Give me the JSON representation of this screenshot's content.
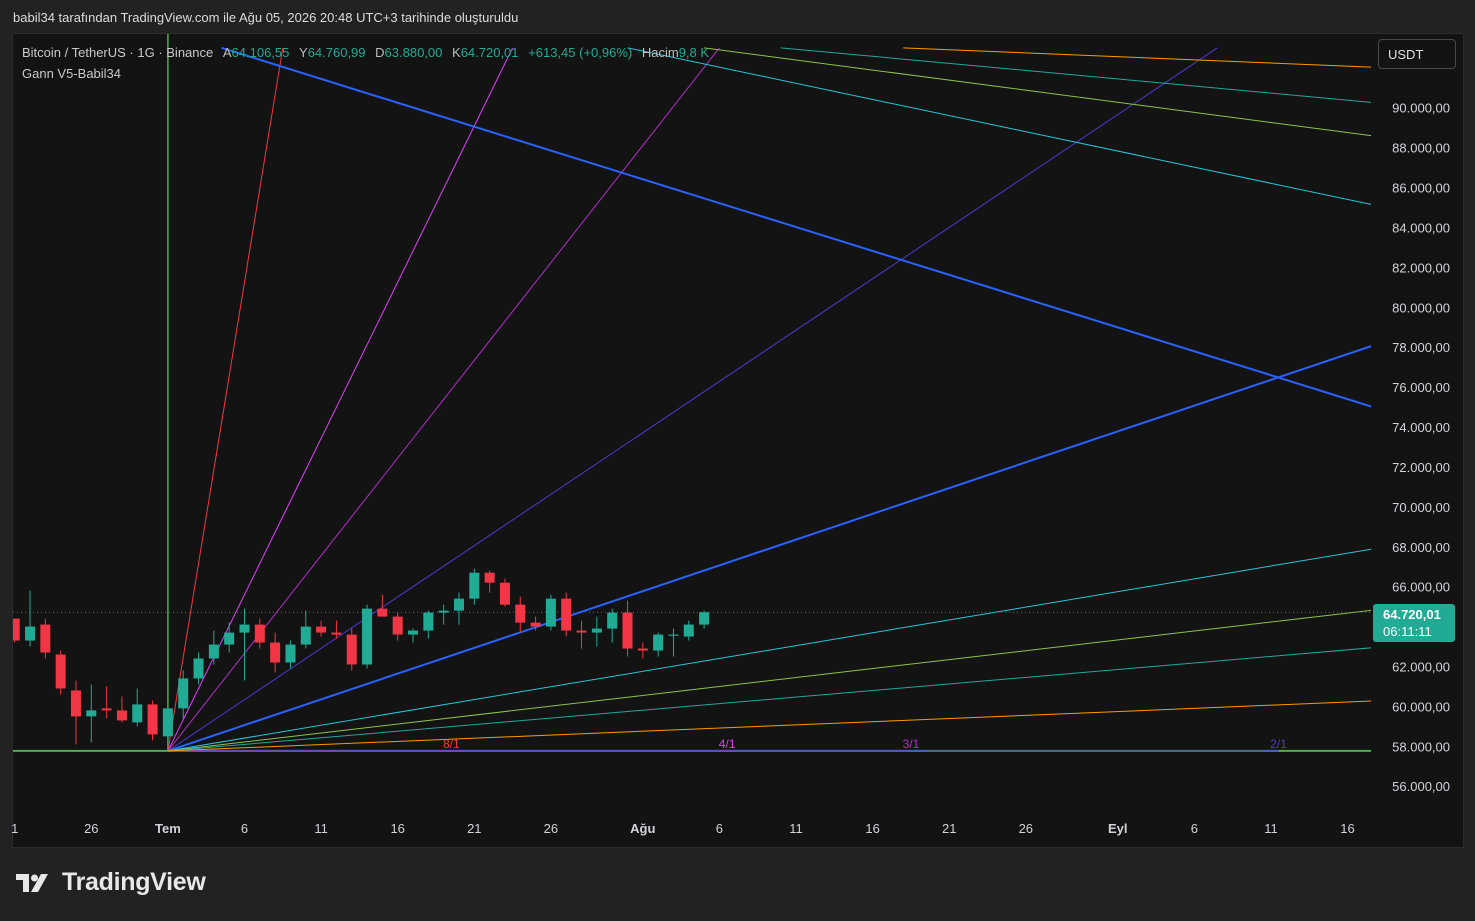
{
  "header": {
    "credit": "babil34 tarafından TradingView.com ile Ağu 05, 2026 20:48 UTC+3 tarihinde oluşturuldu"
  },
  "legend": {
    "symbol": "Bitcoin / TetherUS · 1G · Binance",
    "open_label": "A",
    "open": "64.106,55",
    "high_label": "Y",
    "high": "64.760,99",
    "low_label": "D",
    "low": "63.880,00",
    "close_label": "K",
    "close": "64.720,01",
    "change": "+613,45 (+0,96%)",
    "volume_label": "Hacim",
    "volume": "9,8 K",
    "indicator": "Gann V5-Babil34"
  },
  "currency_button": "USDT",
  "price_tag": {
    "price": "64.720,01",
    "countdown": "06:11:11"
  },
  "brand": {
    "name": "TradingView",
    "icon": "tradingview-logo-icon"
  },
  "colors": {
    "bull": "#22ab94",
    "bear": "#f23645",
    "background": "#131313",
    "baseline": "#4caf50"
  },
  "chart_data": {
    "type": "candlestick",
    "y_axis": {
      "ticks": [
        56000,
        58000,
        60000,
        62000,
        64000,
        66000,
        68000,
        70000,
        72000,
        74000,
        76000,
        78000,
        80000,
        82000,
        84000,
        86000,
        88000,
        90000
      ],
      "tick_labels": [
        "56.000,00",
        "58.000,00",
        "60.000,00",
        "62.000,00",
        "",
        "66.000,00",
        "68.000,00",
        "70.000,00",
        "72.000,00",
        "74.000,00",
        "76.000,00",
        "78.000,00",
        "80.000,00",
        "82.000,00",
        "84.000,00",
        "86.000,00",
        "88.000,00",
        "90.000,00"
      ],
      "range": [
        55000,
        92500
      ]
    },
    "x_axis": {
      "start_date": "2026-06-21",
      "labels": [
        {
          "day": 0,
          "text": "1"
        },
        {
          "day": 5,
          "text": "26"
        },
        {
          "day": 10,
          "text": "Tem"
        },
        {
          "day": 15,
          "text": "6"
        },
        {
          "day": 20,
          "text": "11"
        },
        {
          "day": 25,
          "text": "16"
        },
        {
          "day": 30,
          "text": "21"
        },
        {
          "day": 35,
          "text": "26"
        },
        {
          "day": 41,
          "text": "Ağu"
        },
        {
          "day": 46,
          "text": "6"
        },
        {
          "day": 51,
          "text": "11"
        },
        {
          "day": 56,
          "text": "16"
        },
        {
          "day": 61,
          "text": "21"
        },
        {
          "day": 66,
          "text": "26"
        },
        {
          "day": 72,
          "text": "Eyl"
        },
        {
          "day": 77,
          "text": "6"
        },
        {
          "day": 82,
          "text": "11"
        },
        {
          "day": 87,
          "text": "16"
        }
      ]
    },
    "last_price": 64720.01,
    "gann_origin": {
      "day": 10,
      "price": 57770
    },
    "gann_baseline": 57770,
    "gann_labels": [
      {
        "text": "8/1",
        "day": 28.5,
        "color": "#f23645"
      },
      {
        "text": "4/1",
        "day": 46.5,
        "color": "#e040fb"
      },
      {
        "text": "3/1",
        "day": 58.5,
        "color": "#b030c8"
      },
      {
        "text": "2/1",
        "day": 82.5,
        "color": "#4a3ad0"
      }
    ],
    "fan_lines": [
      {
        "to": [
          28.5,
          57770
        ],
        "color": "#f23645",
        "width": 1
      },
      {
        "to": [
          46.5,
          57770
        ],
        "color": "#e040fb",
        "width": 1
      },
      {
        "to": [
          58.5,
          57770
        ],
        "color": "#b030c8",
        "width": 1
      },
      {
        "to": [
          82.5,
          57770
        ],
        "color": "#4a3ad0",
        "width": 1
      },
      {
        "to": [
          17.5,
          93000
        ],
        "color": "#f23645",
        "width": 1
      },
      {
        "to": [
          32.5,
          93000
        ],
        "color": "#e040fb",
        "width": 1
      },
      {
        "to": [
          46,
          93000
        ],
        "color": "#b030c8",
        "width": 1
      },
      {
        "to": [
          78.5,
          93000
        ],
        "color": "#4a3ad0",
        "width": 1
      },
      {
        "to": [
          89.5,
          78300
        ],
        "color": "#2962ff",
        "width": 2
      },
      {
        "to": [
          89.5,
          68000
        ],
        "color": "#26c6da",
        "width": 1
      },
      {
        "to": [
          89.5,
          64900
        ],
        "color": "#8bc34a",
        "width": 1
      },
      {
        "to": [
          89.5,
          63000
        ],
        "color": "#26a69a",
        "width": 1
      },
      {
        "to": [
          89.5,
          60300
        ],
        "color": "#ff9800",
        "width": 1
      }
    ],
    "down_lines": [
      {
        "from": [
          13.5,
          93000
        ],
        "to": [
          89.5,
          74800
        ],
        "color": "#2962ff",
        "width": 2
      },
      {
        "from": [
          40,
          93000
        ],
        "to": [
          89.5,
          85000
        ],
        "color": "#26c6da",
        "width": 1
      },
      {
        "from": [
          45,
          93000
        ],
        "to": [
          89.5,
          88500
        ],
        "color": "#8bc34a",
        "width": 1
      },
      {
        "from": [
          50,
          93000
        ],
        "to": [
          89.5,
          90200
        ],
        "color": "#26a69a",
        "width": 1
      },
      {
        "from": [
          58,
          93000
        ],
        "to": [
          89.5,
          92000
        ],
        "color": "#ff9800",
        "width": 1
      }
    ],
    "candles": [
      {
        "d": 0,
        "o": 64400,
        "h": 64400,
        "l": 63200,
        "c": 63300
      },
      {
        "d": 1,
        "o": 63300,
        "h": 65800,
        "l": 63000,
        "c": 64000
      },
      {
        "d": 2,
        "o": 64100,
        "h": 64400,
        "l": 62400,
        "c": 62700
      },
      {
        "d": 3,
        "o": 62600,
        "h": 62800,
        "l": 60600,
        "c": 60900
      },
      {
        "d": 4,
        "o": 60800,
        "h": 61300,
        "l": 58100,
        "c": 59500
      },
      {
        "d": 5,
        "o": 59500,
        "h": 61100,
        "l": 58200,
        "c": 59800
      },
      {
        "d": 6,
        "o": 59900,
        "h": 61000,
        "l": 59400,
        "c": 59800
      },
      {
        "d": 7,
        "o": 59800,
        "h": 60500,
        "l": 59200,
        "c": 59300
      },
      {
        "d": 8,
        "o": 59200,
        "h": 60900,
        "l": 59000,
        "c": 60100
      },
      {
        "d": 9,
        "o": 60100,
        "h": 60300,
        "l": 58300,
        "c": 58600
      },
      {
        "d": 10,
        "o": 58500,
        "h": 60000,
        "l": 57800,
        "c": 59900
      },
      {
        "d": 11,
        "o": 59900,
        "h": 61800,
        "l": 59400,
        "c": 61400
      },
      {
        "d": 12,
        "o": 61400,
        "h": 62700,
        "l": 61100,
        "c": 62400
      },
      {
        "d": 13,
        "o": 62400,
        "h": 63800,
        "l": 62100,
        "c": 63100
      },
      {
        "d": 14,
        "o": 63100,
        "h": 64200,
        "l": 62700,
        "c": 63700
      },
      {
        "d": 15,
        "o": 63700,
        "h": 64900,
        "l": 61300,
        "c": 64100
      },
      {
        "d": 16,
        "o": 64100,
        "h": 64400,
        "l": 62900,
        "c": 63200
      },
      {
        "d": 17,
        "o": 63200,
        "h": 63700,
        "l": 61700,
        "c": 62200
      },
      {
        "d": 18,
        "o": 62200,
        "h": 63300,
        "l": 61900,
        "c": 63100
      },
      {
        "d": 19,
        "o": 63100,
        "h": 64800,
        "l": 62900,
        "c": 64000
      },
      {
        "d": 20,
        "o": 64000,
        "h": 64300,
        "l": 63500,
        "c": 63700
      },
      {
        "d": 21,
        "o": 63700,
        "h": 64300,
        "l": 63400,
        "c": 63600
      },
      {
        "d": 22,
        "o": 63600,
        "h": 63900,
        "l": 61800,
        "c": 62100
      },
      {
        "d": 23,
        "o": 62100,
        "h": 65100,
        "l": 61900,
        "c": 64900
      },
      {
        "d": 24,
        "o": 64900,
        "h": 65600,
        "l": 64500,
        "c": 64500
      },
      {
        "d": 25,
        "o": 64500,
        "h": 64700,
        "l": 63300,
        "c": 63600
      },
      {
        "d": 26,
        "o": 63600,
        "h": 63900,
        "l": 63200,
        "c": 63800
      },
      {
        "d": 27,
        "o": 63800,
        "h": 64800,
        "l": 63400,
        "c": 64700
      },
      {
        "d": 28,
        "o": 64700,
        "h": 65100,
        "l": 64100,
        "c": 64800
      },
      {
        "d": 29,
        "o": 64800,
        "h": 65700,
        "l": 64100,
        "c": 65400
      },
      {
        "d": 30,
        "o": 65400,
        "h": 66900,
        "l": 65100,
        "c": 66700
      },
      {
        "d": 31,
        "o": 66700,
        "h": 66800,
        "l": 65700,
        "c": 66200
      },
      {
        "d": 32,
        "o": 66200,
        "h": 66400,
        "l": 65000,
        "c": 65100
      },
      {
        "d": 33,
        "o": 65100,
        "h": 65500,
        "l": 63700,
        "c": 64200
      },
      {
        "d": 34,
        "o": 64200,
        "h": 64500,
        "l": 63800,
        "c": 64000
      },
      {
        "d": 35,
        "o": 64000,
        "h": 65600,
        "l": 63800,
        "c": 65400
      },
      {
        "d": 36,
        "o": 65400,
        "h": 65700,
        "l": 63500,
        "c": 63800
      },
      {
        "d": 37,
        "o": 63800,
        "h": 64300,
        "l": 62900,
        "c": 63700
      },
      {
        "d": 38,
        "o": 63700,
        "h": 64500,
        "l": 63000,
        "c": 63900
      },
      {
        "d": 39,
        "o": 63900,
        "h": 64900,
        "l": 63200,
        "c": 64700
      },
      {
        "d": 40,
        "o": 64700,
        "h": 65300,
        "l": 62500,
        "c": 62900
      },
      {
        "d": 41,
        "o": 62900,
        "h": 63200,
        "l": 62400,
        "c": 62800
      },
      {
        "d": 42,
        "o": 62800,
        "h": 63700,
        "l": 62500,
        "c": 63600
      },
      {
        "d": 43,
        "o": 63600,
        "h": 63900,
        "l": 62500,
        "c": 63600
      },
      {
        "d": 44,
        "o": 63500,
        "h": 64300,
        "l": 63300,
        "c": 64100
      },
      {
        "d": 45,
        "o": 64100,
        "h": 64800,
        "l": 63900,
        "c": 64720
      }
    ]
  }
}
